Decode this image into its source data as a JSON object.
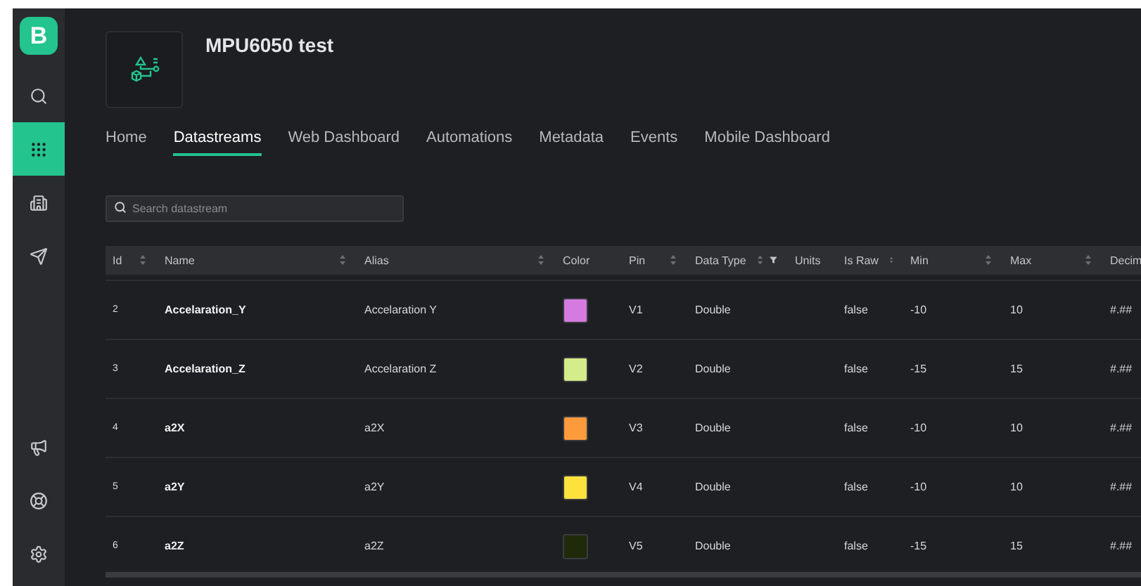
{
  "sidebar": {
    "logo": "B",
    "top_items": [
      {
        "kind": "search",
        "selected": false
      },
      {
        "kind": "grid",
        "selected": true
      },
      {
        "kind": "building",
        "selected": false
      },
      {
        "kind": "send",
        "selected": false
      }
    ],
    "bottom_items": [
      {
        "kind": "megaphone",
        "selected": false
      },
      {
        "kind": "lifebuoy",
        "selected": false
      },
      {
        "kind": "settings",
        "selected": false
      }
    ]
  },
  "project": {
    "title": "MPU6050 test"
  },
  "tabs": [
    {
      "label": "Home",
      "selected": false
    },
    {
      "label": "Datastreams",
      "selected": true
    },
    {
      "label": "Web Dashboard",
      "selected": false
    },
    {
      "label": "Automations",
      "selected": false
    },
    {
      "label": "Metadata",
      "selected": false
    },
    {
      "label": "Events",
      "selected": false
    },
    {
      "label": "Mobile Dashboard",
      "selected": false
    }
  ],
  "search": {
    "placeholder": "Search datastream"
  },
  "table": {
    "columns": [
      {
        "label": "Id",
        "sortable": true,
        "filter": false
      },
      {
        "label": "Name",
        "sortable": true,
        "filter": false
      },
      {
        "label": "Alias",
        "sortable": true,
        "filter": false
      },
      {
        "label": "Color",
        "sortable": false,
        "filter": false
      },
      {
        "label": "Pin",
        "sortable": true,
        "filter": false
      },
      {
        "label": "Data Type",
        "sortable": true,
        "filter": true
      },
      {
        "label": "Units"
      },
      {
        "label": "Is Raw",
        "sortable": true,
        "filter": false
      },
      {
        "label": "Min",
        "sortable": true,
        "filter": false
      },
      {
        "label": "Max",
        "sortable": true,
        "filter": false
      },
      {
        "label": "Decim"
      }
    ],
    "rows": [
      {
        "id": "2",
        "name": "Accelaration_Y",
        "alias": "Accelaration Y",
        "color": "#d57be0",
        "pin": "V1",
        "data_type": "Double",
        "is_raw": "false",
        "min": "-10",
        "max": "10",
        "decimals": "#.##"
      },
      {
        "id": "3",
        "name": "Accelaration_Z",
        "alias": "Accelaration Z",
        "color": "#d4ec8a",
        "pin": "V2",
        "data_type": "Double",
        "is_raw": "false",
        "min": "-15",
        "max": "15",
        "decimals": "#.##"
      },
      {
        "id": "4",
        "name": "a2X",
        "alias": "a2X",
        "color": "#fd9b3c",
        "pin": "V3",
        "data_type": "Double",
        "is_raw": "false",
        "min": "-10",
        "max": "10",
        "decimals": "#.##"
      },
      {
        "id": "5",
        "name": "a2Y",
        "alias": "a2Y",
        "color": "#fde23d",
        "pin": "V4",
        "data_type": "Double",
        "is_raw": "false",
        "min": "-10",
        "max": "10",
        "decimals": "#.##"
      },
      {
        "id": "6",
        "name": "a2Z",
        "alias": "a2Z",
        "color": "#1f2a0a",
        "pin": "V5",
        "data_type": "Double",
        "is_raw": "false",
        "min": "-15",
        "max": "15",
        "decimals": "#.##"
      }
    ]
  }
}
